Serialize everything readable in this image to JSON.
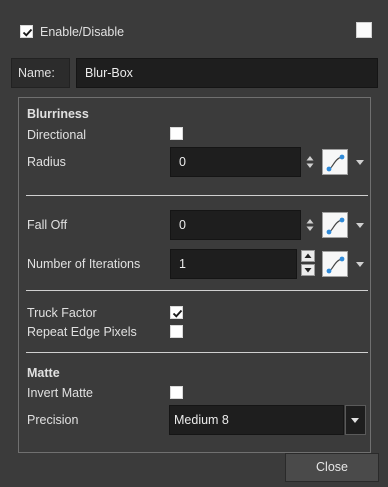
{
  "header": {
    "enable_label": "Enable/Disable",
    "enable_checked": true
  },
  "name_field": {
    "label": "Name:",
    "value": "Blur-Box"
  },
  "blurriness": {
    "title": "Blurriness",
    "directional_label": "Directional",
    "directional_checked": false,
    "radius_label": "Radius",
    "radius_value": "0"
  },
  "falloff": {
    "label": "Fall Off",
    "value": "0"
  },
  "iterations": {
    "label": "Number of Iterations",
    "value": "1"
  },
  "options": {
    "truck_factor_label": "Truck Factor",
    "truck_factor_checked": true,
    "repeat_edge_label": "Repeat Edge Pixels",
    "repeat_edge_checked": false
  },
  "matte": {
    "title": "Matte",
    "invert_label": "Invert Matte",
    "invert_checked": false,
    "precision_label": "Precision",
    "precision_value": "Medium 8"
  },
  "footer": {
    "close_label": "Close"
  },
  "icons": {
    "bezier": "function-curve-icon",
    "spinner": "up-down-arrows-icon",
    "dropdown": "chevron-down-icon"
  },
  "colors": {
    "background": "#3b3b3b",
    "field": "#1e1e1e",
    "accent_blue": "#2f8ad8"
  }
}
